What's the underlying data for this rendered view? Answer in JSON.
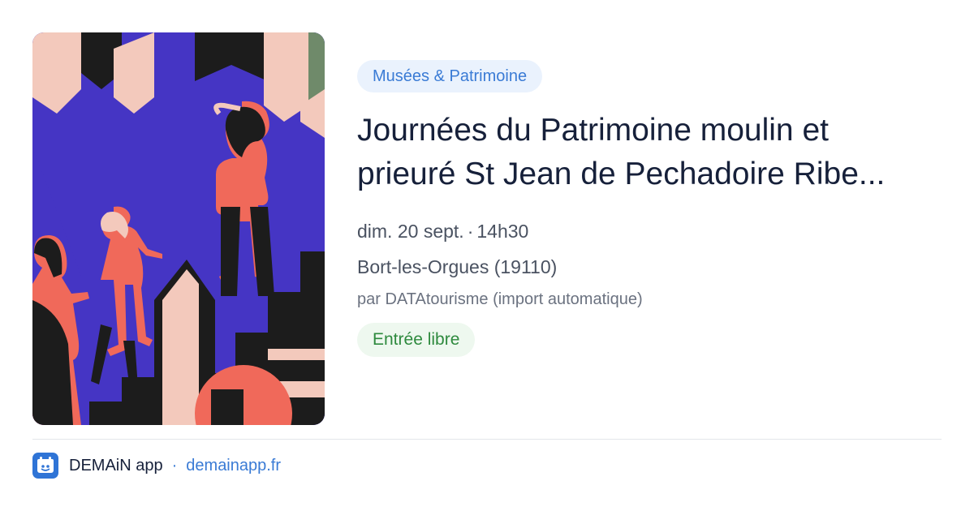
{
  "event": {
    "category": "Musées & Patrimoine",
    "title": "Journées du Patrimoine moulin et prieuré St Jean de Pechadoire Ribe...",
    "date": "dim. 20 sept.",
    "time": "14h30",
    "location": "Bort-les-Orgues (19110)",
    "organizer": "par DATAtourisme (import automatique)",
    "price": "Entrée libre",
    "image_icon": "illustration-people-climbing-stairs"
  },
  "footer": {
    "app_name": "DEMAiN app",
    "separator": "·",
    "domain": "demainapp.fr",
    "logo_icon": "demain-app-logo-icon"
  },
  "colors": {
    "category_bg": "#eaf2fd",
    "category_text": "#3a7bd5",
    "price_bg": "#eef8ef",
    "price_text": "#2e8a3e",
    "title": "#16203a",
    "accent": "#3a7bd5",
    "illustration_bg": "#4535c4",
    "illustration_coral": "#f0695a"
  }
}
